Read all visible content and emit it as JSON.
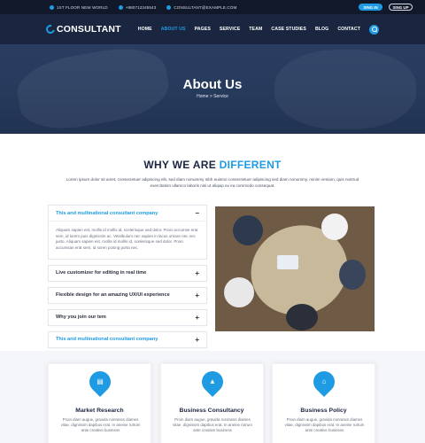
{
  "topbar": {
    "address": "1ST FLOOR NEW WORLD",
    "phone": "+880712345543",
    "email": "CONSULTANT@EXAMPLE.COM",
    "signin": "SING IN",
    "signup": "SING UP"
  },
  "brand": {
    "name": "CONSULTANT"
  },
  "nav": {
    "items": [
      "HOME",
      "ABOUT US",
      "PAGES",
      "SERVICE",
      "TEAM",
      "CASE STUDIES",
      "BLOG",
      "CONTACT"
    ],
    "active_index": 1
  },
  "hero": {
    "title": "About Us",
    "breadcrumb": "Home > Service"
  },
  "section": {
    "title_main": "WHY WE ARE ",
    "title_accent": "DIFFERENT",
    "intro": "Lorem ipsum dolor sit amet, consectetuer adipiscing elit, sed diam nonummy nibh euismo consectetuer adipiscing sed diam nonummy. minim veniam, quis nostrud exercitation ullamco laboris nisi ut aliquip ex ea commodo consequat."
  },
  "accordion": [
    {
      "title": "This and multinational consultant company",
      "open": true,
      "sign": "−",
      "body": "Aliquam sapien est, mollis id mollis id, scelerisque sed dolor. Proin accumse erat sem, id lorem puis dignissim ac. Vestibulum nec sapien in lacus ornare nec nec justo. Aliquam sapien est, mollis id mollis id, scelerisque sed dolor. Proin accumsan erat sem, id soren posing porta nec."
    },
    {
      "title": "Live customizer for editing in real time",
      "open": false,
      "sign": "+"
    },
    {
      "title": "Flexible design for an amazing UX/UI experience",
      "open": false,
      "sign": "+"
    },
    {
      "title": "Why you join our tem",
      "open": false,
      "sign": "+"
    },
    {
      "title": "This and multinational consultant company",
      "open": false,
      "sign": "+",
      "highlight": true
    }
  ],
  "cards": [
    {
      "title": "Market Research",
      "icon": "book-icon",
      "text": "Proin diam augue, gravida nonrasss diames vitae, dignissim dapibus erat. In aneine rutrum ante creative business"
    },
    {
      "title": "Business Consultancy",
      "icon": "graduation-cap-icon",
      "text": "Proin diam augue, gravida nonrasss diames vitae, dignissim dapibus erat. In aneine rutrum ante creative business"
    },
    {
      "title": "Business Policy",
      "icon": "bank-icon",
      "text": "Proin diam augue, gravida nonrasss diames vitae, dignissim dapibus erat. In aneine rutrum ante creative business"
    }
  ],
  "colors": {
    "accent": "#1e9be2",
    "dark": "#1a2640",
    "heading": "#1c2440"
  }
}
